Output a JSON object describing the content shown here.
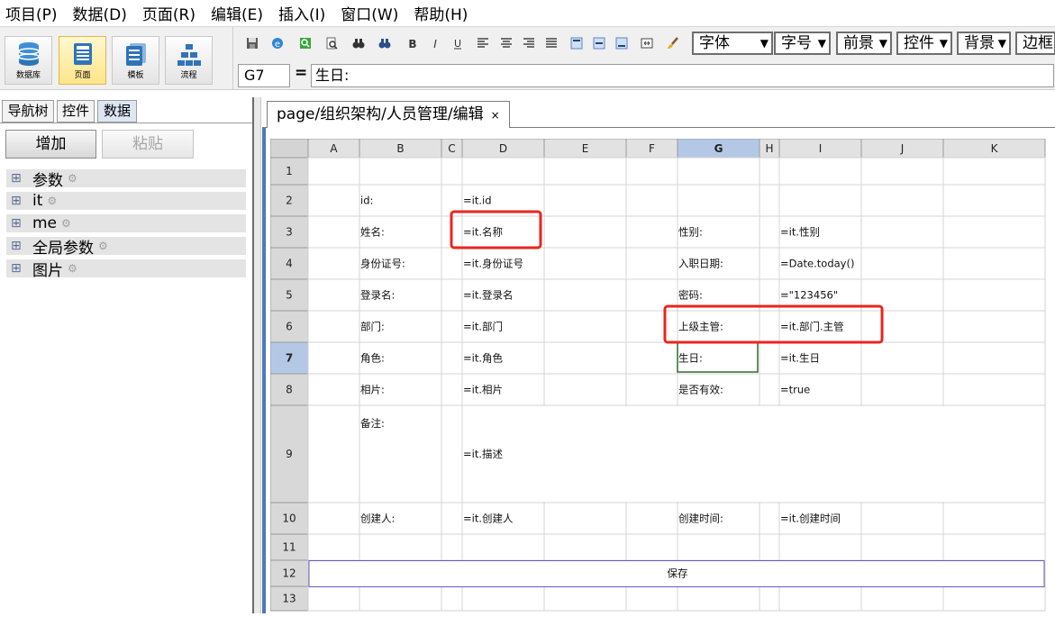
{
  "menu": [
    "项目(P)",
    "数据(D)",
    "页面(R)",
    "编辑(E)",
    "插入(I)",
    "窗口(W)",
    "帮助(H)"
  ],
  "big_toolbar": [
    {
      "label": "数据库",
      "icon": "database-icon",
      "active": false
    },
    {
      "label": "页面",
      "icon": "page-icon",
      "active": true
    },
    {
      "label": "模板",
      "icon": "template-icon",
      "active": false
    },
    {
      "label": "流程",
      "icon": "flow-icon",
      "active": false
    }
  ],
  "format_toolbar": {
    "icons": [
      "save-icon",
      "ie-icon",
      "find-icon",
      "preview-icon",
      "binoculars-icon",
      "find-next-icon",
      "bold-icon",
      "italic-icon",
      "underline-icon",
      "align-left-icon",
      "align-center-icon",
      "align-right-icon",
      "justify-icon",
      "valign-top-icon",
      "valign-middle-icon",
      "valign-bottom-icon",
      "merge-icon",
      "brush-icon"
    ],
    "combos": [
      "字体",
      "字号",
      "前景",
      "控件",
      "背景",
      "边框"
    ]
  },
  "formula_bar": {
    "cell_ref": "G7",
    "eq": "=",
    "value": "生日:"
  },
  "left_panel": {
    "tabs": [
      "导航树",
      "控件",
      "数据"
    ],
    "selected_tab": "数据",
    "buttons": {
      "add": "增加",
      "paste": "粘贴"
    },
    "tree": [
      "参数",
      "it",
      "me",
      "全局参数",
      "图片"
    ]
  },
  "document_tab": {
    "title": "page/组织架构/人员管理/编辑",
    "close": "×"
  },
  "sheet": {
    "columns": [
      "A",
      "B",
      "C",
      "D",
      "E",
      "F",
      "G",
      "H",
      "I",
      "J",
      "K"
    ],
    "rows": [
      "1",
      "2",
      "3",
      "4",
      "5",
      "6",
      "7",
      "8",
      "9",
      "10",
      "11",
      "12",
      "13"
    ],
    "selected_cell": "G7",
    "cells": [
      {
        "row": 2,
        "col": "B",
        "text": "id:"
      },
      {
        "row": 2,
        "col": "D",
        "text": "=it.id"
      },
      {
        "row": 3,
        "col": "B",
        "text": "姓名:"
      },
      {
        "row": 3,
        "col": "D",
        "text": "=it.名称"
      },
      {
        "row": 3,
        "col": "G",
        "text": "性别:"
      },
      {
        "row": 3,
        "col": "I",
        "text": "=it.性别"
      },
      {
        "row": 4,
        "col": "B",
        "text": "身份证号:"
      },
      {
        "row": 4,
        "col": "D",
        "text": "=it.身份证号"
      },
      {
        "row": 4,
        "col": "G",
        "text": "入职日期:"
      },
      {
        "row": 4,
        "col": "I",
        "text": "=Date.today()"
      },
      {
        "row": 5,
        "col": "B",
        "text": "登录名:"
      },
      {
        "row": 5,
        "col": "D",
        "text": "=it.登录名"
      },
      {
        "row": 5,
        "col": "G",
        "text": "密码:"
      },
      {
        "row": 5,
        "col": "I",
        "text": "=\"123456\""
      },
      {
        "row": 6,
        "col": "B",
        "text": "部门:"
      },
      {
        "row": 6,
        "col": "D",
        "text": "=it.部门"
      },
      {
        "row": 6,
        "col": "G",
        "text": "上级主管:"
      },
      {
        "row": 6,
        "col": "I",
        "text": "=it.部门.主管"
      },
      {
        "row": 7,
        "col": "B",
        "text": "角色:"
      },
      {
        "row": 7,
        "col": "D",
        "text": "=it.角色"
      },
      {
        "row": 7,
        "col": "G",
        "text": "生日:"
      },
      {
        "row": 7,
        "col": "I",
        "text": "=it.生日"
      },
      {
        "row": 8,
        "col": "B",
        "text": "相片:"
      },
      {
        "row": 8,
        "col": "D",
        "text": "=it.相片"
      },
      {
        "row": 8,
        "col": "G",
        "text": "是否有效:"
      },
      {
        "row": 8,
        "col": "I",
        "text": "=true"
      },
      {
        "row": 9,
        "col": "B",
        "text": "备注:"
      },
      {
        "row": 9,
        "col": "D",
        "text": "=it.描述"
      },
      {
        "row": 10,
        "col": "B",
        "text": "创建人:"
      },
      {
        "row": 10,
        "col": "D",
        "text": "=it.创建人"
      },
      {
        "row": 10,
        "col": "G",
        "text": "创建时间:"
      },
      {
        "row": 10,
        "col": "I",
        "text": "=it.创建时间"
      },
      {
        "row": 12,
        "col": "F",
        "text": "保存"
      }
    ],
    "highlights": [
      "D3",
      "G6:I6"
    ],
    "highlight_color": "#e8261e"
  }
}
